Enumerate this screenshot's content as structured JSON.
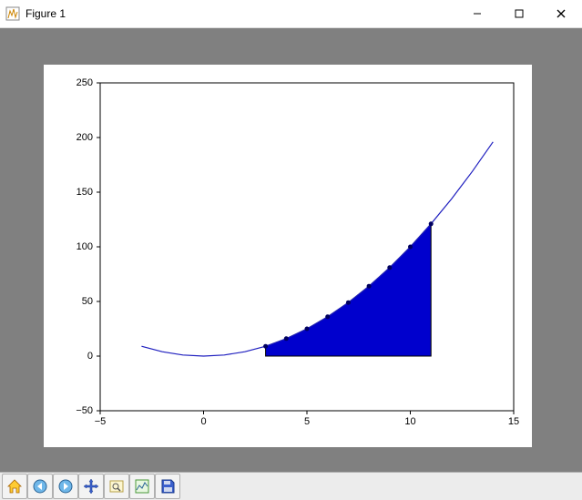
{
  "window": {
    "title": "Figure 1",
    "minimize_label": "Minimize",
    "maximize_label": "Maximize",
    "close_label": "Close"
  },
  "toolbar": {
    "items": [
      {
        "name": "home-icon",
        "label": "Home"
      },
      {
        "name": "back-icon",
        "label": "Back"
      },
      {
        "name": "forward-icon",
        "label": "Forward"
      },
      {
        "name": "pan-icon",
        "label": "Pan"
      },
      {
        "name": "zoom-icon",
        "label": "Zoom"
      },
      {
        "name": "subplots-icon",
        "label": "Configure Subplots"
      },
      {
        "name": "save-icon",
        "label": "Save"
      }
    ]
  },
  "chart_data": {
    "type": "line+area",
    "title": "",
    "xlabel": "",
    "ylabel": "",
    "xlim": [
      -5,
      15
    ],
    "ylim": [
      -50,
      250
    ],
    "xticks": [
      -5,
      0,
      5,
      10,
      15
    ],
    "yticks": [
      -50,
      0,
      50,
      100,
      150,
      200,
      250
    ],
    "curve": {
      "color": "#1f1fbf",
      "x": [
        -3,
        -2,
        -1,
        0,
        1,
        2,
        3,
        4,
        5,
        6,
        7,
        8,
        9,
        10,
        11,
        12,
        13,
        14
      ],
      "y": [
        9,
        4,
        1,
        0,
        1,
        4,
        9,
        16,
        25,
        36,
        49,
        64,
        81,
        100,
        121,
        144,
        169,
        196
      ]
    },
    "markers": {
      "x": [
        3,
        4,
        5,
        6,
        7,
        8,
        9,
        10,
        11
      ],
      "y": [
        9,
        16,
        25,
        36,
        49,
        64,
        81,
        100,
        121
      ]
    },
    "fill": {
      "color": "#0000cd",
      "x_start": 3,
      "x_end": 11,
      "baseline": 0
    }
  }
}
